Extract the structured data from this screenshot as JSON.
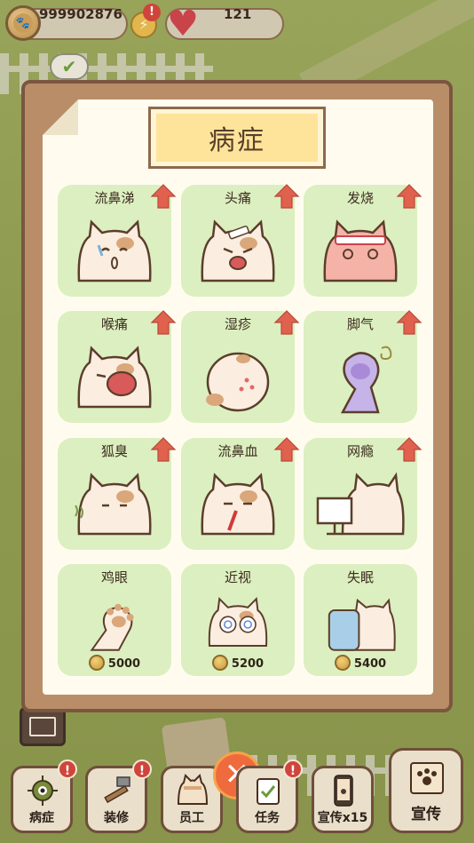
{
  "hud": {
    "coins": "999902876",
    "hearts": "121",
    "alert_mark": "!"
  },
  "panel": {
    "title": "病症"
  },
  "diseases": [
    {
      "label": "流鼻涕",
      "icon": "cat-runny-nose-icon",
      "upgradable": true
    },
    {
      "label": "头痛",
      "icon": "cat-headache-icon",
      "upgradable": true
    },
    {
      "label": "发烧",
      "icon": "cat-fever-icon",
      "upgradable": true
    },
    {
      "label": "喉痛",
      "icon": "cat-sore-throat-icon",
      "upgradable": true
    },
    {
      "label": "湿疹",
      "icon": "cat-eczema-icon",
      "upgradable": true
    },
    {
      "label": "脚气",
      "icon": "paw-athletes-foot-icon",
      "upgradable": true
    },
    {
      "label": "狐臭",
      "icon": "cat-body-odor-icon",
      "upgradable": true
    },
    {
      "label": "流鼻血",
      "icon": "cat-nosebleed-icon",
      "upgradable": true
    },
    {
      "label": "网瘾",
      "icon": "cat-internet-addiction-icon",
      "upgradable": true
    },
    {
      "label": "鸡眼",
      "icon": "paw-corn-icon",
      "upgradable": false,
      "price": "5000"
    },
    {
      "label": "近视",
      "icon": "cat-myopia-icon",
      "upgradable": false,
      "price": "5200"
    },
    {
      "label": "失眠",
      "icon": "cat-insomnia-icon",
      "upgradable": false,
      "price": "5400"
    }
  ],
  "menu": {
    "close_symbol": "✕",
    "items": [
      {
        "label": "病症",
        "icon": "virus-icon",
        "alert": "!"
      },
      {
        "label": "装修",
        "icon": "hammer-icon",
        "alert": "!"
      },
      {
        "label": "员工",
        "icon": "staff-cat-icon",
        "alert": "!"
      },
      {
        "label": "任务",
        "icon": "checklist-icon",
        "alert": "!"
      },
      {
        "label": "宣传x15",
        "icon": "phone-paw-icon"
      }
    ],
    "promo": {
      "label": "宣传",
      "icon": "scroll-paw-icon"
    }
  },
  "colors": {
    "card_bg": "#dcefc0",
    "arrow_red": "#e0614e",
    "title_yellow": "#fde49a",
    "board_brown": "#b88d68",
    "close_orange": "#ef6a3c"
  }
}
